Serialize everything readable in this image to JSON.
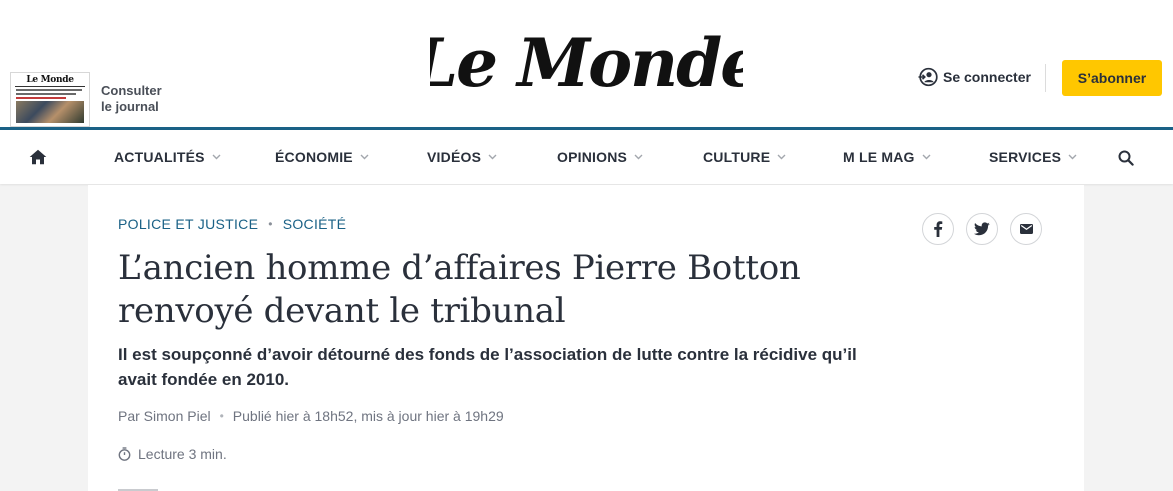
{
  "header": {
    "journal_lines": [
      "Consulter",
      "le journal"
    ],
    "journal_thumb_logo": "Le Monde",
    "masthead": "Le Monde",
    "login_label": "Se connecter",
    "subscribe_label": "S’abonner",
    "colors": {
      "nav_rule": "#1a6186",
      "subscribe_bg": "#ffc700"
    }
  },
  "nav": {
    "home_icon": "home-icon",
    "items": [
      {
        "label": "ACTUALITÉS"
      },
      {
        "label": "ÉCONOMIE"
      },
      {
        "label": "VIDÉOS"
      },
      {
        "label": "OPINIONS"
      },
      {
        "label": "CULTURE"
      },
      {
        "label": "M LE MAG"
      },
      {
        "label": "SERVICES"
      }
    ],
    "search_icon": "search-icon"
  },
  "article": {
    "categories": [
      "POLICE ET JUSTICE",
      "SOCIÉTÉ"
    ],
    "share": [
      "facebook-icon",
      "twitter-icon",
      "mail-icon"
    ],
    "title": "L’ancien homme d’affaires Pierre Botton renvoyé devant le tribunal",
    "description": "Il est soupçonné d’avoir détourné des fonds de l’association de lutte contre la récidive qu’il avait fondée en 2010.",
    "author": "Par Simon Piel",
    "published": "Publié hier à 18h52, mis à jour hier à 19h29",
    "reading_time": "Lecture 3 min."
  }
}
